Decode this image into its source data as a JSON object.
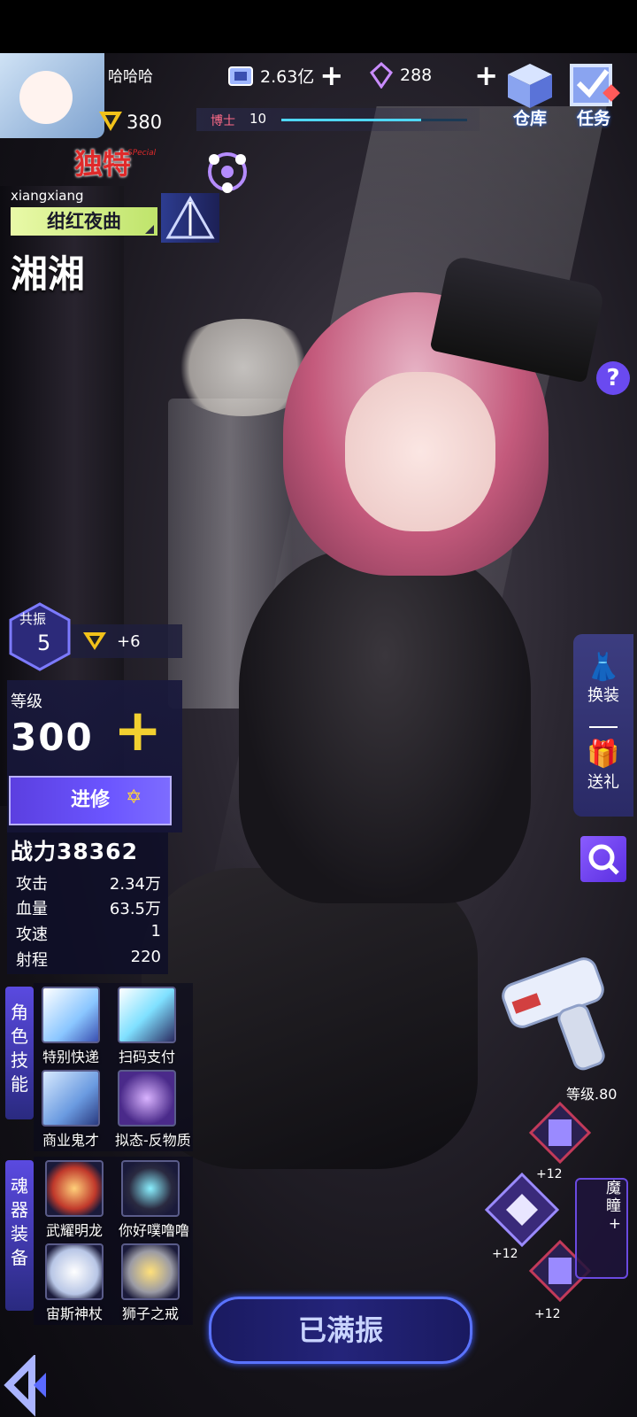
{
  "player": {
    "name": "哈哈哈",
    "level": "380"
  },
  "resources": {
    "gold": "2.63亿",
    "gems": "288"
  },
  "doctor": {
    "label": "博士",
    "level": "10",
    "progress": 0.75
  },
  "top_buttons": {
    "warehouse": "仓库",
    "tasks": "任务"
  },
  "character": {
    "rarity": "独特",
    "rarity_sub": "SPecial",
    "pinyin": "xiangxiang",
    "skin": "绀红夜曲",
    "name": "湘湘"
  },
  "resonance": {
    "label": "共振",
    "level": "5",
    "bonus": "+6"
  },
  "stats": {
    "level_label": "等级",
    "level": "300",
    "advance": "进修",
    "power": "战力38362",
    "rows": [
      {
        "label": "攻击",
        "value": "2.34万"
      },
      {
        "label": "血量",
        "value": "63.5万"
      },
      {
        "label": "攻速",
        "value": "1"
      },
      {
        "label": "射程",
        "value": "220"
      }
    ]
  },
  "skills": {
    "tab": [
      "角",
      "色",
      "技",
      "能"
    ],
    "items": [
      "特别快递",
      "扫码支付",
      "商业鬼才",
      "拟态-反物质"
    ]
  },
  "equipment": {
    "tab": [
      "魂",
      "器",
      "装",
      "备"
    ],
    "items": [
      "武耀明龙",
      "你好噗噜噜",
      "宙斯神杖",
      "狮子之戒"
    ]
  },
  "right_menu": {
    "outfit": "换装",
    "gift": "送礼"
  },
  "weapon": {
    "level": "等级.80"
  },
  "equip_levels": [
    "+12",
    "+12",
    "+12"
  ],
  "devil_eye": [
    "魔",
    "瞳",
    "+"
  ],
  "max_button": "已满振",
  "colors": {
    "accent": "#5a4ae0",
    "rarity": "#e02a2a",
    "gold_plus": "#f2d030",
    "skin_tag": "#d8f08c"
  }
}
